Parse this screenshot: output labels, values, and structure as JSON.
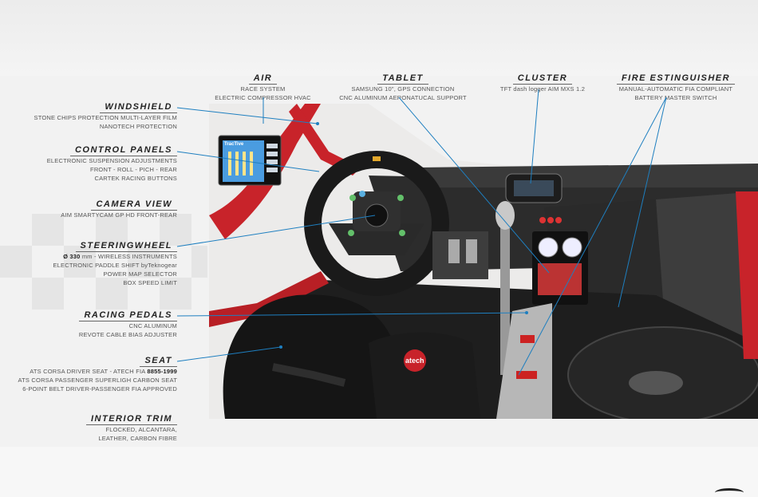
{
  "labels": {
    "air": {
      "title": "AIR",
      "lines": [
        "RACE SYSTEM",
        "ELECTRIC COMPRESSOR HVAC"
      ]
    },
    "tablet": {
      "title": "TABLET",
      "lines": [
        "SAMSUNG 10\", GPS CONNECTION",
        "CNC ALUMINUM AERONATUCAL SUPPORT"
      ]
    },
    "cluster": {
      "title": "CLUSTER",
      "lines": [
        "TFT dash logger AIM MXS 1.2"
      ]
    },
    "fire": {
      "title": "FIRE ESTINGUISHER",
      "lines": [
        "MANUAL-AUTOMATIC FIA COMPLIANT",
        "BATTERY MASTER SWITCH"
      ]
    },
    "windshield": {
      "title": "WINDSHIELD",
      "lines": [
        "STONE CHIPS PROTECTION MULTI-LAYER FILM",
        "NANOTECH PROTECTION"
      ]
    },
    "control": {
      "title": "CONTROL PANELS",
      "lines": [
        "ELECTRONIC SUSPENSION ADJUSTMENTS",
        "FRONT - ROLL - PICH - REAR",
        "CARTEK RACING BUTTONS"
      ]
    },
    "camera": {
      "title": "CAMERA VIEW",
      "lines": [
        "AIM SMARTYCAM GP HD  FRONT-REAR"
      ]
    },
    "steering": {
      "title": "STEERINGWHEEL",
      "line1_bold": "Ø 330",
      "line1_rest": "mm - WIRELESS INSTRUMENTS",
      "lines": [
        "ELECTRONIC PADDLE SHIFT byTeknogear",
        "POWER MAP SELECTOR",
        "BOX SPEED LIMIT"
      ]
    },
    "pedals": {
      "title": "RACING PEDALS",
      "lines": [
        "CNC ALUMINUM",
        "REVOTE CABLE BIAS ADJUSTER"
      ]
    },
    "seat": {
      "title": "SEAT",
      "line1_pre": "ATS CORSA DRIVER SEAT - ATECH FIA ",
      "line1_bold": "8855-1999",
      "lines": [
        "ATS CORSA PASSENGER SUPERLIGH CARBON SEAT",
        "6-POINT BELT DRIVER-PASSENGER FIA APPROVED"
      ]
    },
    "trim": {
      "title": "INTERIOR TRIM",
      "lines": [
        "FLOCKED, ALCANTARA,",
        "LEATHER, CARBON FIBRE"
      ]
    }
  },
  "photo": {
    "panel_brand": "TracTive",
    "seat_brand": "atech"
  },
  "colors": {
    "leader": "#1e7fc0",
    "rollcage": "#c8232a",
    "dash": "#2c2c2c"
  }
}
